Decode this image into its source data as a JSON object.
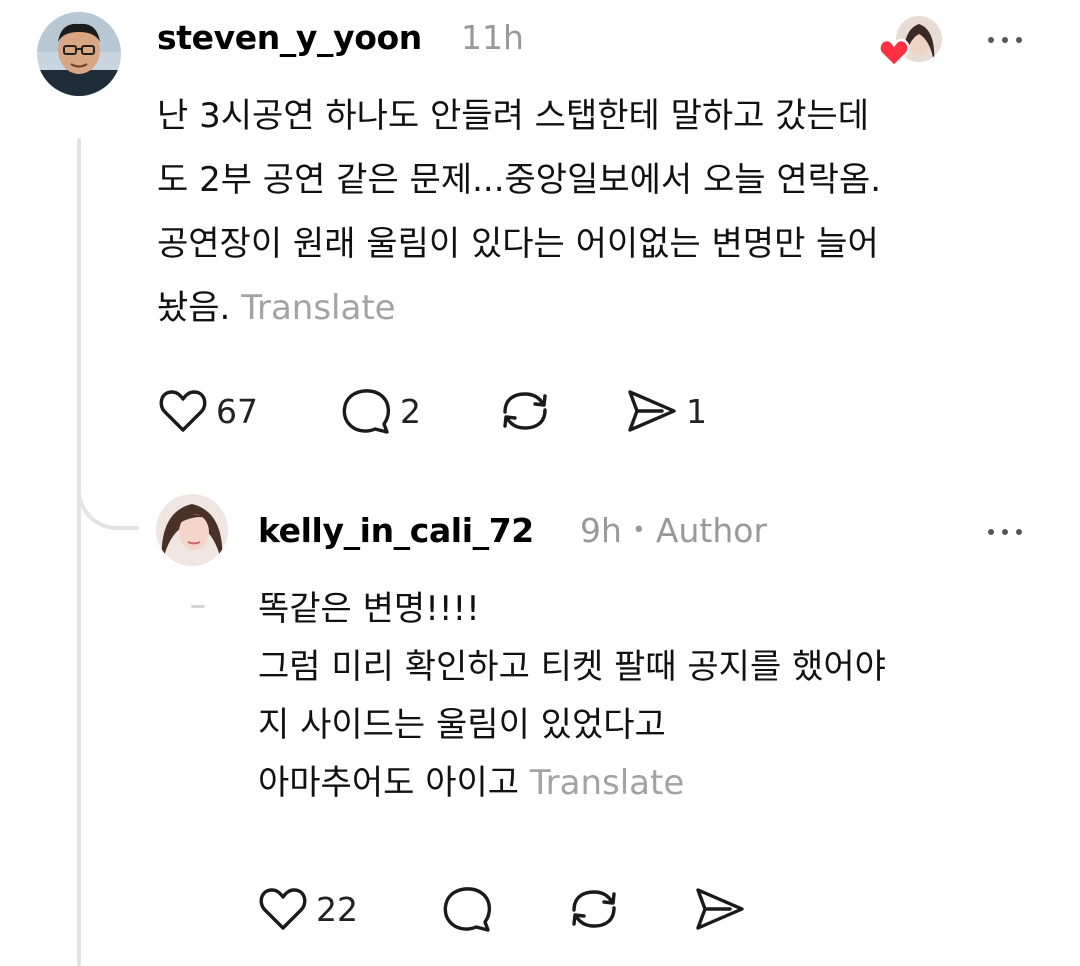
{
  "post": {
    "username": "steven_y_yoon",
    "time": "11h",
    "lines": [
      "난 3시공연 하나도 안들려 스탭한테 말하고 갔는데",
      "도 2부 공연 같은 문제...중앙일보에서 오늘 연락옴.",
      "공연장이 원래 울림이 있다는 어이없는 변명만 늘어",
      "놨음."
    ],
    "translate_label": "Translate",
    "actions": {
      "likes": "67",
      "replies": "2",
      "reposts": "",
      "shares": "1"
    },
    "liked_by_icon": "liked-by-avatar-with-heart"
  },
  "reply": {
    "username": "kelly_in_cali_72",
    "time": "9h",
    "separator": "•",
    "author_label": "Author",
    "lines": [
      "똑같은 변명!!!!",
      "그럼 미리 확인하고 티켓 팔때 공지를 했어야",
      "지 사이드는 울림이 있었다고",
      "아마추어도 아이고"
    ],
    "translate_label": "Translate",
    "actions": {
      "likes": "22"
    }
  },
  "icons": {
    "like": "heart-icon",
    "reply": "speech-bubble-icon",
    "repost": "repost-icon",
    "share": "send-icon",
    "more": "more-dots-icon"
  },
  "colors": {
    "text": "#000000",
    "muted": "#999999",
    "heart_red": "#ff3040",
    "thread_line": "#e3e3e3"
  }
}
